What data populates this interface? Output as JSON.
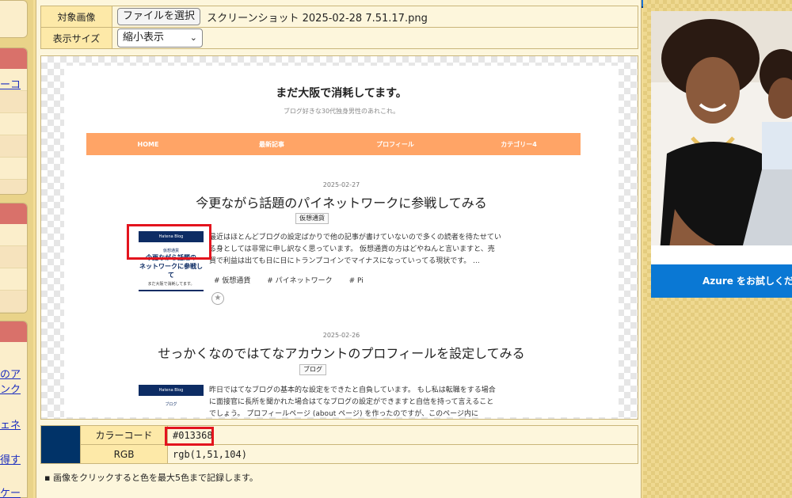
{
  "form": {
    "image_label": "対象画像",
    "file_button": "ファイルを選択",
    "file_name": "スクリーンショット 2025-02-28 7.51.17.png",
    "size_label": "表示サイズ",
    "size_value": "縮小表示"
  },
  "sidebar": {
    "links": [
      "ーコ",
      "のア",
      "ンク",
      "ェネ",
      "得す",
      "ケー"
    ]
  },
  "blog": {
    "title": "まだ大阪で消耗してます。",
    "subtitle": "ブログ好きな30代独身男性のあれこれ。",
    "nav": [
      "HOME",
      "最新記事",
      "プロフィール",
      "カテゴリー4"
    ],
    "posts": [
      {
        "date": "2025-02-27",
        "title": "今更ながら話題のパイネットワークに参戦してみる",
        "category": "仮想通貨",
        "thumb_bar": "Hatena Blog",
        "thumb_tiny": "仮想通貨",
        "thumb_big_1": "今更ながら話題の",
        "thumb_big_2": "ネットワークに参戦して",
        "thumb_tiny2": "まだ大阪で消耗してます。",
        "excerpt_1": "最近はほとんどブログの設定ばかりで他の記事が書けていないので多くの読者を待たせてい",
        "excerpt_2": "る身としては非常に申し訳なく思っています。 仮想通貨の方はどやねんと言いますと、売",
        "excerpt_3": "買で利益は出ても日に日にトランプコインでマイナスになっていってる現状です。 ...",
        "tags": [
          "# 仮想通貨",
          "# パイネットワーク",
          "# Pi"
        ]
      },
      {
        "date": "2025-02-26",
        "title": "せっかくなのではてなアカウントのプロフィールを設定してみる",
        "category": "ブログ",
        "thumb_bar": "Hatena Blog",
        "thumb_tiny": "ブログ",
        "excerpt_1": "昨日ではてなブログの基本的な設定をできたと自負しています。 もし私は転職をする場合",
        "excerpt_2": "に面接官に長所を聞かれた場合はてなブログの設定ができますと自信を持って言えること",
        "excerpt_3": "でしょう。 プロフィールページ (about ページ) を作ったのですが、このページ内に"
      }
    ]
  },
  "color_result": {
    "swatch_color": "#013368",
    "code_label": "カラーコード",
    "code_value": "#013368",
    "rgb_label": "RGB",
    "rgb_value": "rgb(1,51,104)"
  },
  "note": "▪ 画像をクリックすると色を最大5色まで記録します。",
  "ad": {
    "cta": "Azure をお試しくだ"
  }
}
